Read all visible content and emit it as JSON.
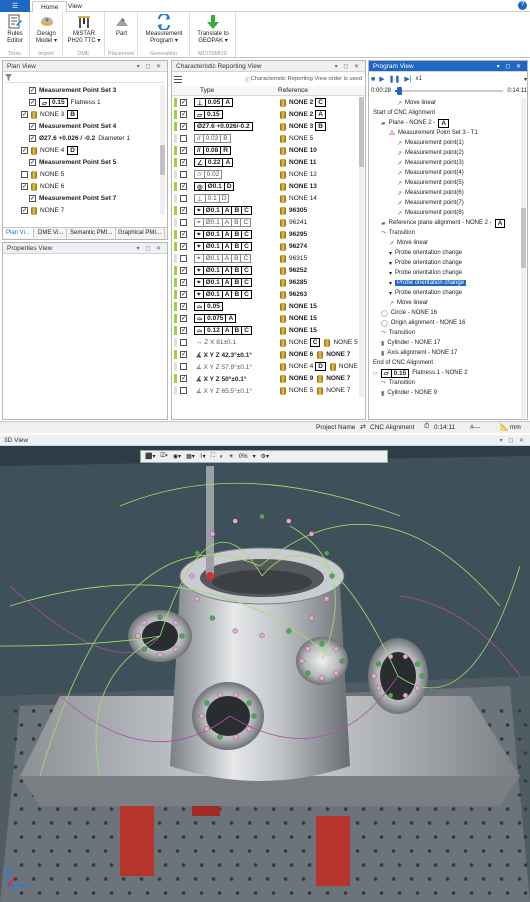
{
  "ribbon": {
    "app_button": "☰",
    "tabs": [
      "Home",
      "View"
    ],
    "groups": [
      {
        "label": "Tools",
        "buttons": [
          "Rules Editor"
        ]
      },
      {
        "label": "Import",
        "buttons": [
          "Design Model ▾"
        ]
      },
      {
        "label": "DME",
        "buttons": [
          "MiSTAR PH20 TTC ▾"
        ]
      },
      {
        "label": "Placement",
        "buttons": [
          "Part"
        ]
      },
      {
        "label": "Generation",
        "buttons": [
          "Measurement Program ▾"
        ]
      },
      {
        "label": "MCOSMOS",
        "buttons": [
          "Translate to GEOPAK ▾"
        ]
      }
    ]
  },
  "plan_view": {
    "title": "Plan View",
    "items": [
      {
        "label": "Measurement Point Set 3",
        "checked": true
      },
      {
        "label": "Flatness 1",
        "frame": [
          "0.15"
        ],
        "checked": true
      },
      {
        "label": "NONE 3",
        "datum": "B",
        "checked": true
      },
      {
        "label": "Measurement Point Set 4",
        "checked": true
      },
      {
        "label": "Diameter 1",
        "dim": "27.6",
        "tol": "+0.026 / -0.2",
        "checked": true
      },
      {
        "label": "NONE 4",
        "datum": "D",
        "checked": true
      },
      {
        "label": "Measurement Point Set 5",
        "checked": true
      },
      {
        "label": "NONE 5",
        "checked": false
      },
      {
        "label": "NONE 6",
        "checked": true
      },
      {
        "label": "Measurement Point Set 7",
        "checked": true
      },
      {
        "label": "NONE 7",
        "checked": true
      }
    ],
    "bottom_tabs": [
      "Plan Vi...",
      "DME Vi...",
      "Semantic PMI...",
      "Graphical PMI..."
    ]
  },
  "properties_view": {
    "title": "Properties View"
  },
  "crv": {
    "title": "Characteristic Reporting View",
    "notice": "Characteristic Reporting View order is used",
    "col_type": "Type",
    "col_ref": "Reference",
    "rows": [
      {
        "on": true,
        "sym": "⊥",
        "frame": [
          "0.05",
          "A"
        ],
        "ref": "NONE 2",
        "rd": "C",
        "bold": true
      },
      {
        "on": true,
        "sym": "▱",
        "frame": [
          "0.15"
        ],
        "ref": "NONE 2",
        "rd": "A",
        "bold": true
      },
      {
        "on": true,
        "sym": "",
        "frame": [
          "Ø27.6 +0.026/-0.2"
        ],
        "ref": "NONE 3",
        "rd": "B",
        "bold": true
      },
      {
        "on": false,
        "sym": "//",
        "frame": [
          "0.03",
          "B"
        ],
        "ref": "NONE 5",
        "rd": "",
        "bold": false
      },
      {
        "on": true,
        "sym": "//",
        "frame": [
          "0.08",
          "R"
        ],
        "ref": "NONE 10",
        "rd": "",
        "bold": true
      },
      {
        "on": true,
        "sym": "∠",
        "frame": [
          "0.22",
          "A"
        ],
        "ref": "NONE 11",
        "rd": "",
        "bold": true
      },
      {
        "on": false,
        "sym": "⌭",
        "frame": [
          "0.02"
        ],
        "ref": "NONE 12",
        "rd": "",
        "bold": false
      },
      {
        "on": true,
        "sym": "◎",
        "frame": [
          "Ø0.1",
          "D"
        ],
        "ref": "NONE 13",
        "rd": "",
        "bold": true
      },
      {
        "on": false,
        "sym": "⊥",
        "frame": [
          "0.1",
          "D"
        ],
        "ref": "NONE 14",
        "rd": "",
        "bold": false
      },
      {
        "on": true,
        "sym": "⌖",
        "frame": [
          "Ø0.1",
          "A",
          "B",
          "C"
        ],
        "ref": "96305",
        "rd": "",
        "bold": true
      },
      {
        "on": false,
        "sym": "⌖",
        "frame": [
          "Ø0.1",
          "A",
          "B",
          "C"
        ],
        "ref": "96241",
        "rd": "",
        "bold": false
      },
      {
        "on": true,
        "sym": "⌖",
        "frame": [
          "Ø0.1",
          "A",
          "B",
          "C"
        ],
        "ref": "96295",
        "rd": "",
        "bold": true
      },
      {
        "on": true,
        "sym": "⌖",
        "frame": [
          "Ø0.1",
          "A",
          "B",
          "C"
        ],
        "ref": "96274",
        "rd": "",
        "bold": true
      },
      {
        "on": false,
        "sym": "⌖",
        "frame": [
          "Ø0.1",
          "A",
          "B",
          "C"
        ],
        "ref": "96315",
        "rd": "",
        "bold": false
      },
      {
        "on": true,
        "sym": "⌖",
        "frame": [
          "Ø0.1",
          "A",
          "B",
          "C"
        ],
        "ref": "96252",
        "rd": "",
        "bold": true
      },
      {
        "on": true,
        "sym": "⌖",
        "frame": [
          "Ø0.1",
          "A",
          "B",
          "C"
        ],
        "ref": "96285",
        "rd": "",
        "bold": true
      },
      {
        "on": true,
        "sym": "⌖",
        "frame": [
          "Ø0.1",
          "A",
          "B",
          "C"
        ],
        "ref": "96263",
        "rd": "",
        "bold": true
      },
      {
        "on": true,
        "sym": "⌓",
        "frame": [
          "0.05"
        ],
        "ref": "NONE 15",
        "rd": "",
        "bold": true
      },
      {
        "on": true,
        "sym": "⌓",
        "frame": [
          "0.075",
          "A"
        ],
        "ref": "NONE 15",
        "rd": "",
        "bold": true
      },
      {
        "on": true,
        "sym": "⌓",
        "frame": [
          "0.12",
          "A",
          "B",
          "C"
        ],
        "ref": "NONE 15",
        "rd": "",
        "bold": true
      },
      {
        "on": false,
        "sym": "↔",
        "text": "Z X  81±0.1",
        "ref": "NONE",
        "rd": "C",
        "ref2": "NONE 5",
        "bold": false
      },
      {
        "on": true,
        "sym": "∡",
        "text": "X Y Z  42.3°±0.1°",
        "ref": "NONE 6",
        "ref2": "NONE 7",
        "bold": true
      },
      {
        "on": false,
        "sym": "∡",
        "text": "X Y Z  57.8°±0.1°",
        "ref": "NONE 4",
        "rd": "D",
        "ref2": "NONE 8",
        "bold": false
      },
      {
        "on": true,
        "sym": "∡",
        "text": "X Y Z  50°±0.1°",
        "ref": "NONE 9",
        "ref2": "NONE 7",
        "bold": true
      },
      {
        "on": false,
        "sym": "∡",
        "text": "X Y Z  65.5°±0.1°",
        "ref": "NONE 5",
        "ref2": "NONE 7",
        "bold": false
      }
    ]
  },
  "program_view": {
    "title": "Program View",
    "speed": "x1",
    "time_current": "0:00:28",
    "time_total": "0:14:11",
    "progress_fraction": 0.033,
    "items": [
      {
        "t": "Move linear",
        "indent": 3,
        "icon": "move"
      },
      {
        "t": "Start of CNC Alignment",
        "indent": 0,
        "icon": ""
      },
      {
        "t": "Plane - NONE 2 -",
        "indent": 1,
        "icon": "plane",
        "badge": "A"
      },
      {
        "t": "Measurement Point Set 3 - T1",
        "indent": 2,
        "icon": "mps"
      },
      {
        "t": "Measurement point(1)",
        "indent": 3,
        "icon": "move"
      },
      {
        "t": "Measurement point(2)",
        "indent": 3,
        "icon": "move"
      },
      {
        "t": "Measurement point(3)",
        "indent": 3,
        "icon": "move"
      },
      {
        "t": "Measurement point(4)",
        "indent": 3,
        "icon": "move"
      },
      {
        "t": "Measurement point(5)",
        "indent": 3,
        "icon": "move"
      },
      {
        "t": "Measurement point(6)",
        "indent": 3,
        "icon": "move"
      },
      {
        "t": "Measurement point(7)",
        "indent": 3,
        "icon": "move"
      },
      {
        "t": "Measurement point(8)",
        "indent": 3,
        "icon": "move"
      },
      {
        "t": "Reference plane alignment -  NONE 2 -",
        "indent": 1,
        "icon": "plane",
        "badge": "A"
      },
      {
        "t": "Transition",
        "indent": 1,
        "icon": "trans"
      },
      {
        "t": "Move linear",
        "indent": 2,
        "icon": "move"
      },
      {
        "t": "Probe orientation change",
        "indent": 2,
        "icon": "probe"
      },
      {
        "t": "Probe orientation change",
        "indent": 2,
        "icon": "probe"
      },
      {
        "t": "Probe orientation change",
        "indent": 2,
        "icon": "probe"
      },
      {
        "t": "Probe orientation change",
        "indent": 2,
        "icon": "probe",
        "selected": true
      },
      {
        "t": "Probe orientation change",
        "indent": 2,
        "icon": "probe"
      },
      {
        "t": "Move linear",
        "indent": 2,
        "icon": "move"
      },
      {
        "t": "Circle - NONE 16",
        "indent": 1,
        "icon": "circle"
      },
      {
        "t": "Origin alignment -  NONE 16",
        "indent": 1,
        "icon": "circle"
      },
      {
        "t": "Transition",
        "indent": 1,
        "icon": "trans"
      },
      {
        "t": "Cylinder - NONE 17",
        "indent": 1,
        "icon": "cyl"
      },
      {
        "t": "Axis alignment -  NONE 17",
        "indent": 1,
        "icon": "cyl"
      },
      {
        "t": "End of CNC Alignment",
        "indent": 0,
        "icon": ""
      },
      {
        "t": "Flatness 1 -  NONE 2",
        "indent": 0,
        "icon": "flat",
        "frame": "0.15"
      },
      {
        "t": "Transition",
        "indent": 1,
        "icon": "trans"
      },
      {
        "t": "Cylinder - NONE 9",
        "indent": 1,
        "icon": "cyl"
      }
    ]
  },
  "statusbar": {
    "project": "Project Name",
    "mode": "CNC Alignment",
    "time": "0:14:11",
    "hash": "#---",
    "unit": "mm"
  },
  "view3d": {
    "title": "3D View",
    "zoom": "0%"
  },
  "colors": {
    "accent": "#1f66c5",
    "green": "#9bd23c",
    "table": "#3f5561",
    "part": "#b8bcc0"
  }
}
